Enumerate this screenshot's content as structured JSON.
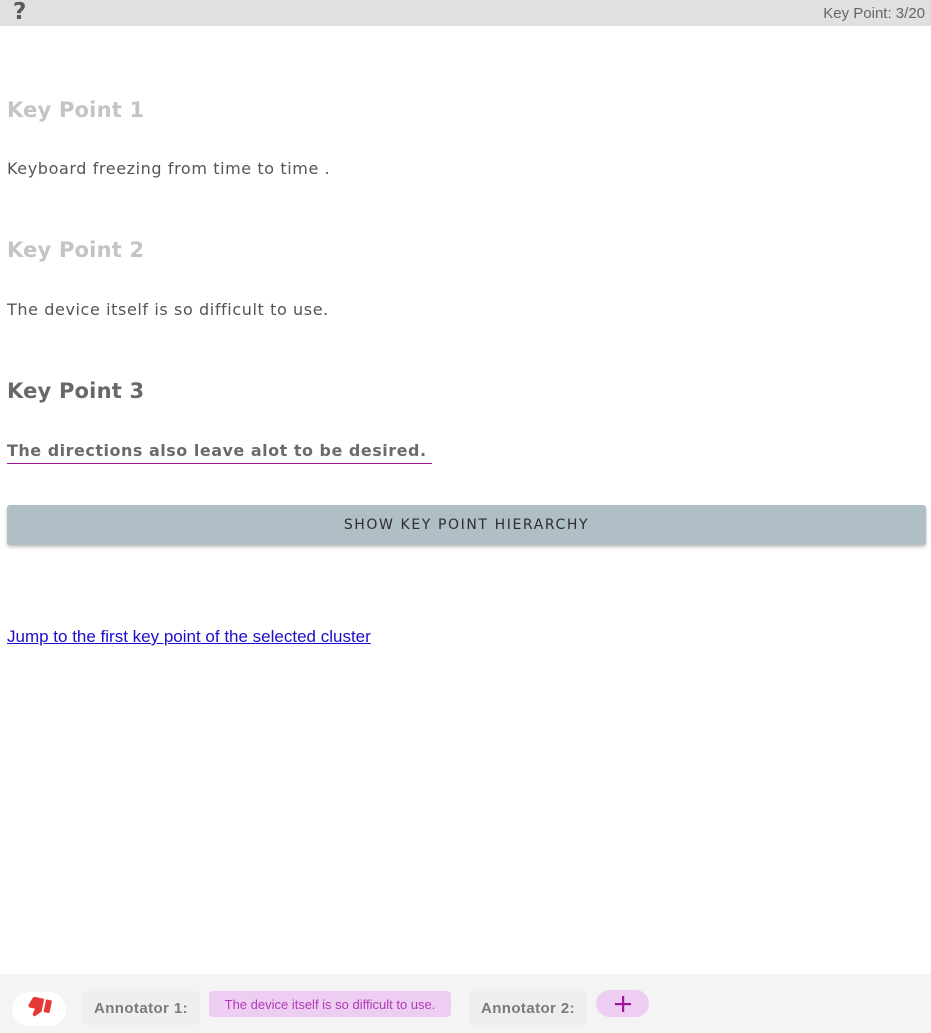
{
  "header": {
    "help_icon": "?",
    "key_point_counter": "Key Point: 3/20"
  },
  "key_points": [
    {
      "heading": "Key Point 1",
      "text": "Keyboard freezing from time to time ."
    },
    {
      "heading": "Key Point 2",
      "text": "The device itself is so difficult to use."
    },
    {
      "heading": "Key Point 3",
      "text": "The directions also leave alot to be desired."
    }
  ],
  "hierarchy_button": {
    "label": "SHOW KEY POINT HIERARCHY"
  },
  "jump_link": {
    "label": "Jump to the first key point of the selected cluster"
  },
  "footer": {
    "thumb_icon": "thumbs-down-icon",
    "annotator_1_label": "Annotator 1:",
    "annotator_1_value": "The device itself is so difficult to use.",
    "annotator_2_label": "Annotator 2:",
    "add_icon": "plus-icon"
  },
  "colors": {
    "accent": "#a0149a",
    "chip_bg": "#eecdf2",
    "chip_text": "#b23ab5",
    "thumb": "#e53935",
    "button_bg": "#b0bec5"
  }
}
